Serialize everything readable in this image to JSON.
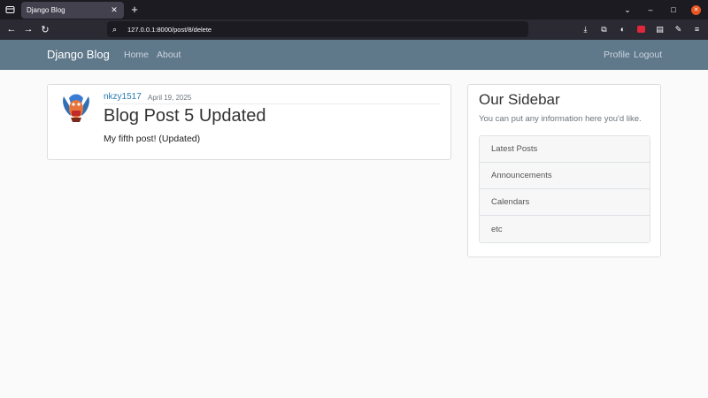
{
  "browser": {
    "tab_title": "Django Blog",
    "tab_close": "✕",
    "new_tab": "+",
    "url": "127.0.0.1:8000/post/8/delete",
    "back": "←",
    "forward": "→",
    "reload": "↻",
    "search_glyph": "⌕",
    "win_min": "–",
    "win_max": "□",
    "win_close": "✕",
    "toolbar_icons": [
      "download-icon",
      "extensions-icon",
      "privacy-icon",
      "pocket-icon",
      "reader-icon",
      "bookmark-icon",
      "menu-icon"
    ]
  },
  "site": {
    "brand": "Django Blog",
    "nav_left": [
      "Home",
      "About"
    ],
    "nav_right": [
      "Profile",
      "Logout"
    ],
    "accent": "#5f788a"
  },
  "post": {
    "author": "nkzy1517",
    "date": "April 19, 2025",
    "title": "Blog Post 5 Updated",
    "content": "My fifth post! (Updated)"
  },
  "sidebar": {
    "title": "Our Sidebar",
    "text": "You can put any information here you'd like.",
    "items": [
      {
        "label": "Latest Posts"
      },
      {
        "label": "Announcements"
      },
      {
        "label": "Calendars"
      },
      {
        "label": "etc"
      }
    ]
  }
}
